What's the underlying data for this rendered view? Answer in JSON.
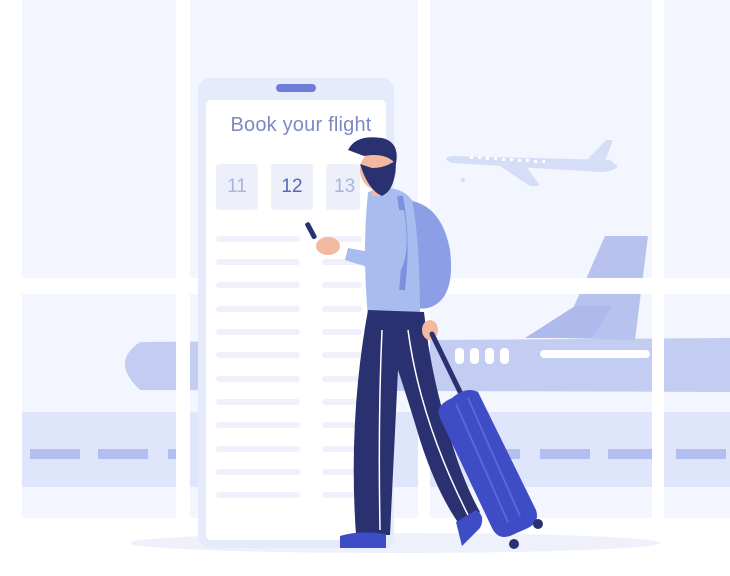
{
  "illustration": {
    "colors": {
      "background": "#f3f6fe",
      "window_frame": "#ffffff",
      "runway": "#dfe5fa",
      "phone_body": "#e6ebfb",
      "phone_screen": "#ffffff",
      "accent": "#3f4bc0",
      "trousers": "#2a3170",
      "shirt": "#a9bcf0",
      "backpack": "#8c9fe6",
      "suitcase": "#3e4cc5"
    }
  },
  "phone": {
    "title": "Book your flight",
    "dates": [
      "11",
      "12",
      "13"
    ],
    "selected_date": "12"
  }
}
